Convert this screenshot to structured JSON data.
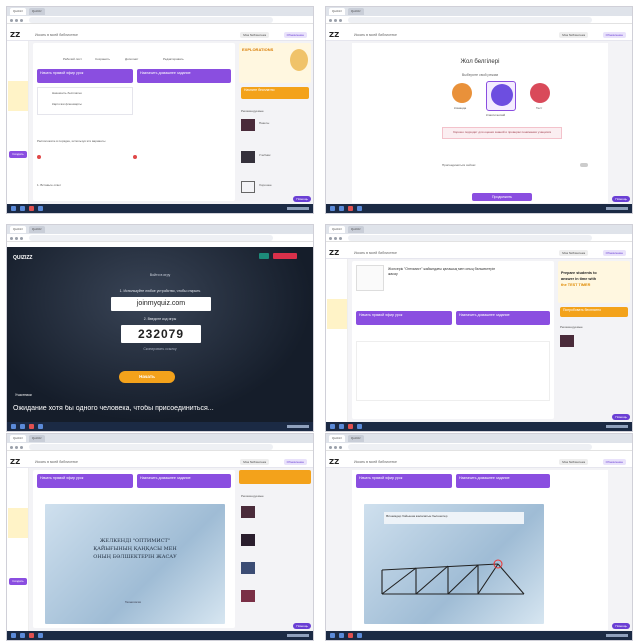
{
  "common": {
    "logo": "ZZ",
    "search_placeholder": "Искать в моей библиотеке",
    "library_btn": "Моя библиотека",
    "upgrade_btn": "Обновление",
    "create_btn": "Создать",
    "chat_btn": "Помощь",
    "host_live": "Начать прямой эфир урок",
    "assign_hw": "Назначить домашнее задание",
    "recommended": "Рекомендуемые",
    "edit_btn": "Изменить"
  },
  "screen1": {
    "actions": [
      "Рабочий лист",
      "Сохранить",
      "Дополнит",
      "Редактировать"
    ],
    "banner_title": "EXPLORATIONS",
    "banner_btn": "Начните бесплатно",
    "homework_title": "Назначить бесплатно",
    "flashcards": "Карточки флешкарты",
    "question_header": "Расположите в порядке, используя эти варианты",
    "footer": "1. Вставьте ответ",
    "right_items": [
      "Рекомендуемые",
      "Пакеты",
      "Учебник",
      "Хорошее"
    ]
  },
  "screen2": {
    "title": "Жол белгілері",
    "subtitle": "Выберите свой режим",
    "modes": [
      "Команда",
      "Классический",
      "Тест"
    ],
    "warning": "Хорошо подходит для оценки знаний и проверки понимания учащихся",
    "participants_label": "Присоединиться сейчас",
    "start_btn": "Продолжить"
  },
  "screen3": {
    "logo": "QUIZIZZ",
    "join_prompt": "Войти в игру",
    "step1": "1. Используйте любое устройство, чтобы открыть",
    "join_url": "joinmyquiz.com",
    "step2": "2. Введите код игры",
    "code": "232079",
    "code_hint": "Скопировать ссылку",
    "start_btn": "Начать",
    "waiting": "Ожидание хотя бы одного человека, чтобы присоединиться...",
    "participants_badge": "Участники"
  },
  "screen4": {
    "quiz_title": "Жолсерік \"Оптимист\" жайындағы қалашық мен оның бөлшектерін жасау",
    "banner_line1": "Prepare students to",
    "banner_line2": "answer in time with",
    "banner_line3": "the TEST TIMER",
    "banner_btn": "Попробовать бесплатно"
  },
  "screen5": {
    "slide_title_line1": "ЖЕЛКЕНДІ \"ОПТИМИСТ\"",
    "slide_title_line2": "ҚАЙЫҒЫНЫҢ ҚАҢҚАСЫ МЕН",
    "slide_title_line3": "ОНЫҢ БӨЛШЕКТЕРІН ЖАСАУ",
    "slide_footer": "Технология"
  },
  "screen6": {
    "slide_text": "Өлшемдер бойынша жасалатын бөлшектер"
  }
}
